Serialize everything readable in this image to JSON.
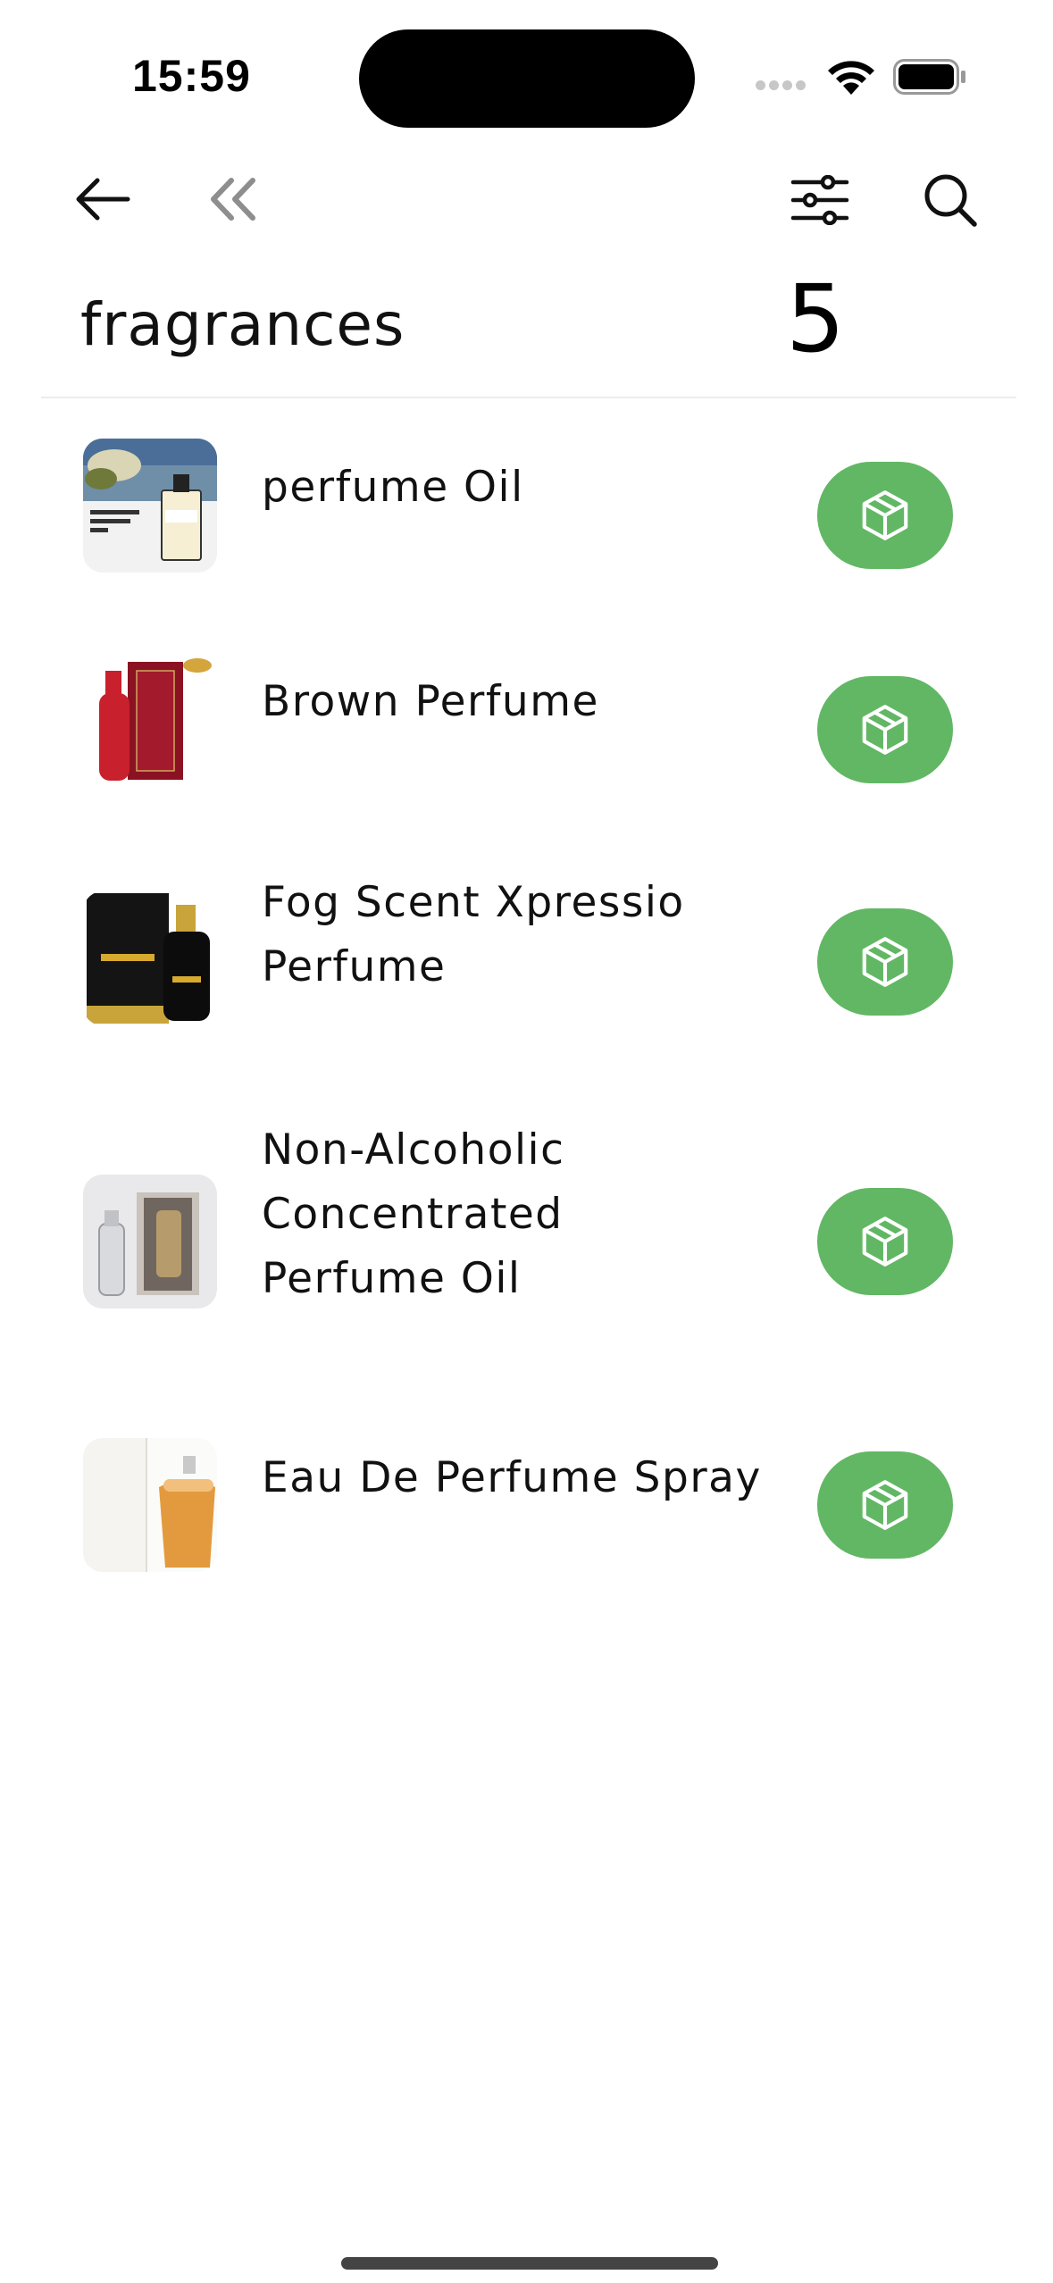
{
  "status_bar": {
    "time": "15:59"
  },
  "header": {
    "title": "fragrances",
    "count": "5"
  },
  "colors": {
    "accent_green": "#62b764"
  },
  "icons": {
    "back": "arrow-left-icon",
    "double_back": "chevrons-left-icon",
    "filter": "sliders-icon",
    "search": "search-icon",
    "item_action": "package-box-icon"
  },
  "products": [
    {
      "name": "perfume Oil"
    },
    {
      "name": "Brown Perfume"
    },
    {
      "name": "Fog Scent Xpressio Perfume"
    },
    {
      "name": "Non-Alcoholic Concentrated Perfume Oil"
    },
    {
      "name": "Eau De Perfume Spray"
    }
  ]
}
